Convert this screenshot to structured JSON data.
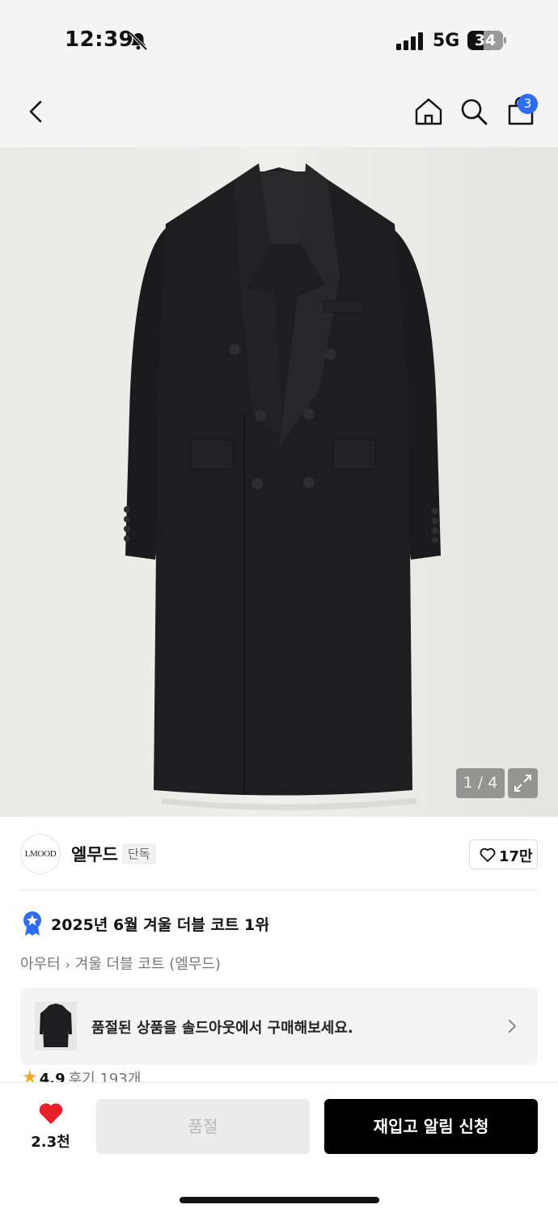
{
  "status_bar": {
    "time": "12:39",
    "network": "5G",
    "battery": "34"
  },
  "nav": {
    "cart_count": "3"
  },
  "gallery": {
    "counter": "1 / 4"
  },
  "brand": {
    "logo_text": "LMOOD",
    "name": "엘무드",
    "tag": "단독",
    "like_count": "17만"
  },
  "ranking": {
    "text": "2025년 6월 겨울 더블 코트 1위",
    "arrow": "›"
  },
  "breadcrumb": {
    "category": "아우터",
    "separator": "›",
    "subcategory": "겨울 더블 코트 (엘무드)"
  },
  "soldout_banner": {
    "text": "품절된 상품을 솔드아웃에서 구매해보세요."
  },
  "rating": {
    "star": "★",
    "score": "4.9",
    "reviews": "후기 193개"
  },
  "actions": {
    "wish_count": "2.3천",
    "soldout_label": "품절",
    "restock_label": "재입고 알림 신청"
  },
  "colors": {
    "accent_blue": "#2f6cf4",
    "heart_red": "#e8202a",
    "star_orange": "#f5a623",
    "primary_button": "#000000"
  }
}
